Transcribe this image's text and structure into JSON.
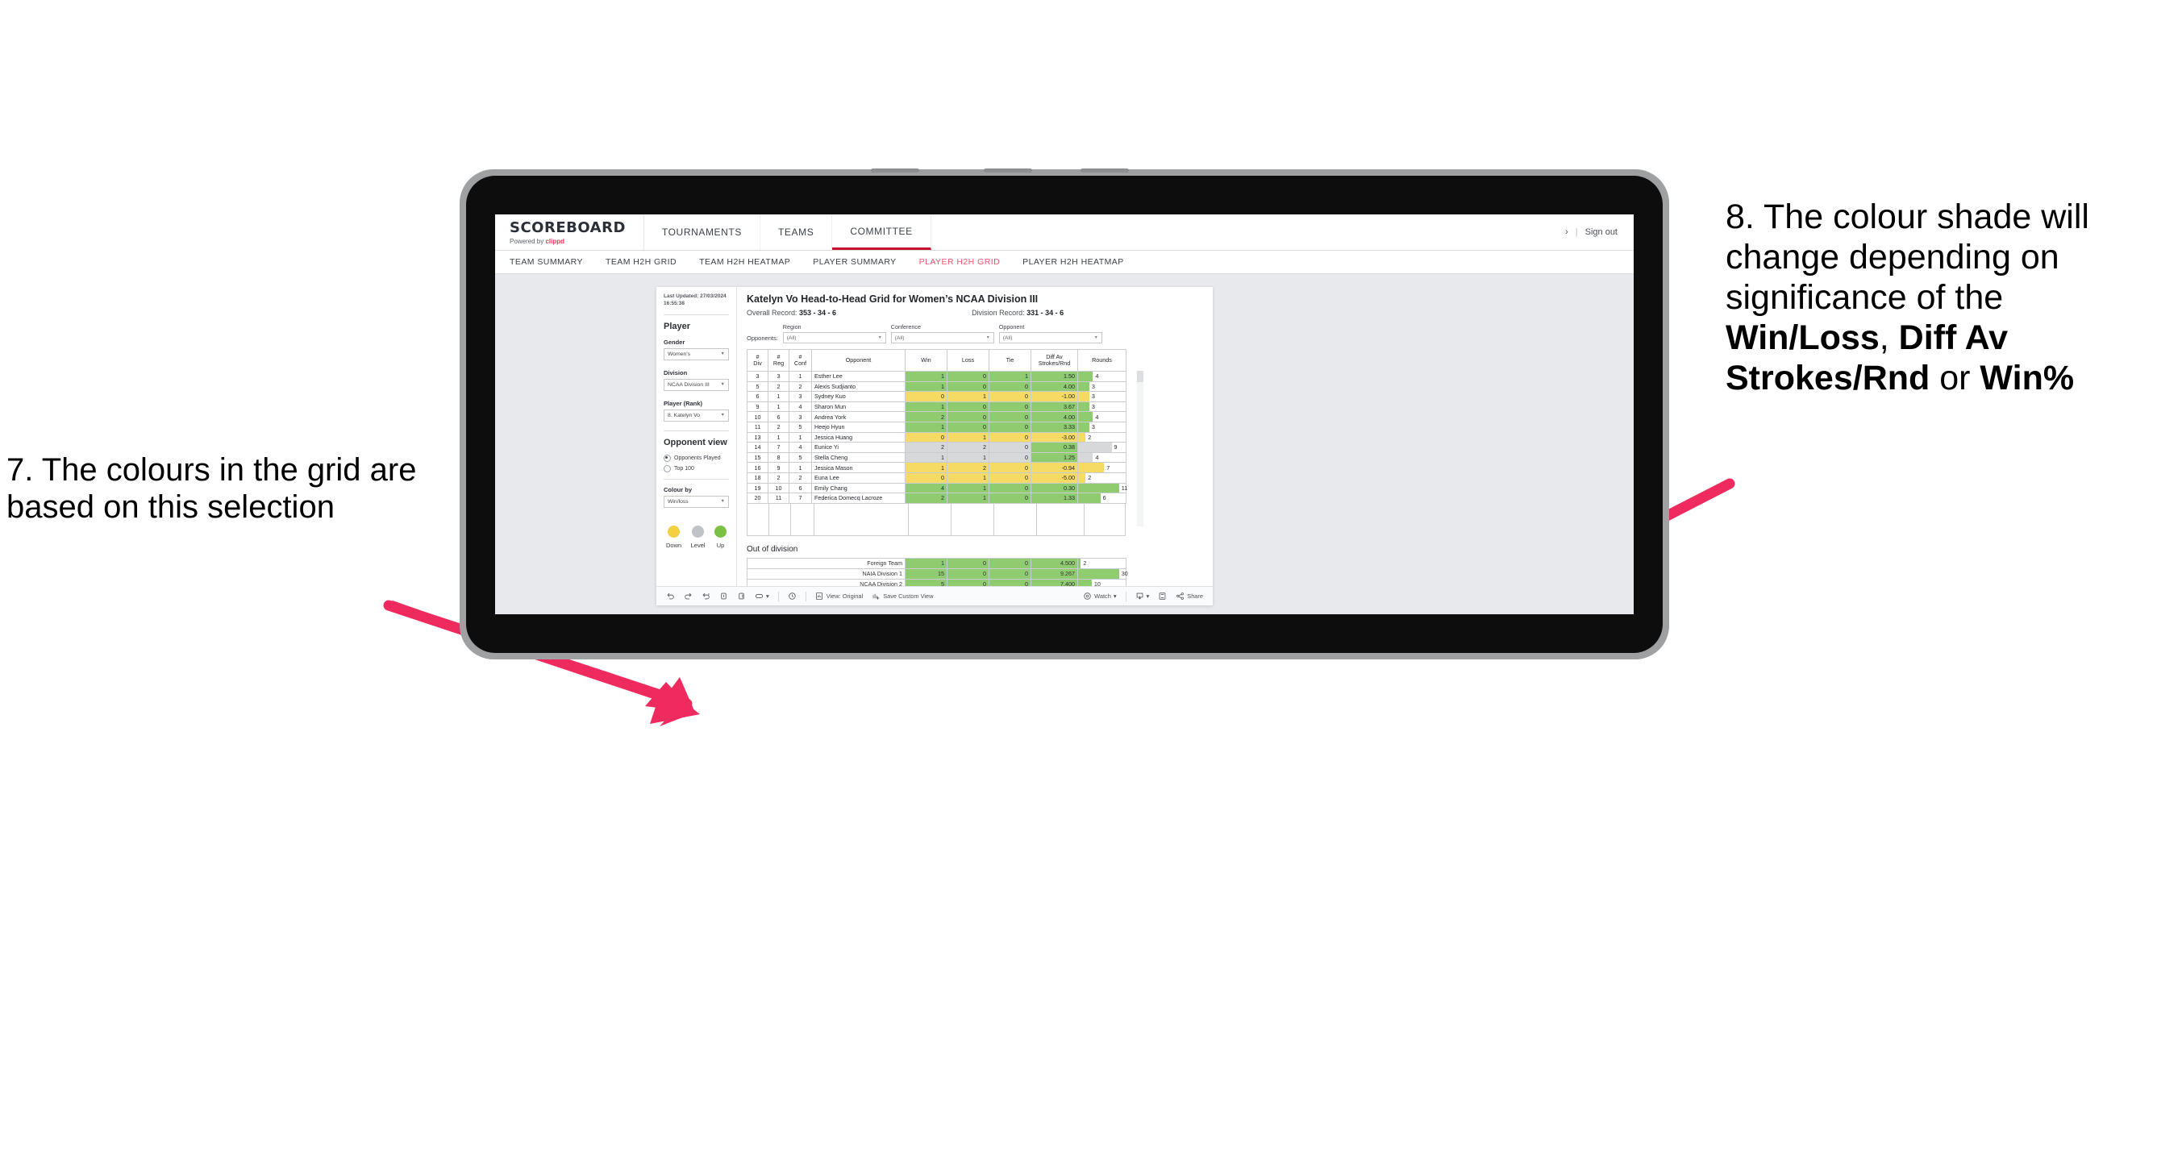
{
  "annotations": {
    "left": {
      "text": "7. The colours in the grid are based on this selection"
    },
    "right": {
      "p1": "8. The colour shade will change depending on significance of the ",
      "b1": "Win/Loss",
      "sep1": ", ",
      "b2": "Diff Av Strokes/Rnd",
      "sep2": " or ",
      "b3": "Win%"
    },
    "arrow_color": "#ef2a5e"
  },
  "app": {
    "brand": {
      "title": "SCOREBOARD",
      "powered_prefix": "Powered by ",
      "powered_name": "clippd"
    },
    "topnav": [
      {
        "label": "TOURNAMENTS",
        "active": false
      },
      {
        "label": "TEAMS",
        "active": false
      },
      {
        "label": "COMMITTEE",
        "active": true
      }
    ],
    "topbar_right": {
      "chevron": "›",
      "divider": "|",
      "sign_out": "Sign out"
    },
    "subnav": [
      {
        "label": "TEAM SUMMARY",
        "active": false
      },
      {
        "label": "TEAM H2H GRID",
        "active": false
      },
      {
        "label": "TEAM H2H HEATMAP",
        "active": false
      },
      {
        "label": "PLAYER SUMMARY",
        "active": false
      },
      {
        "label": "PLAYER H2H GRID",
        "active": true
      },
      {
        "label": "PLAYER H2H HEATMAP",
        "active": false
      }
    ]
  },
  "sidebar": {
    "last_updated": "Last Updated: 27/03/2024 16:55:38",
    "player_heading": "Player",
    "gender_label": "Gender",
    "gender_value": "Women’s",
    "division_label": "Division",
    "division_value": "NCAA Division III",
    "player_rank_label": "Player (Rank)",
    "player_rank_value": "8. Katelyn Vo",
    "opponent_view_heading": "Opponent view",
    "opponent_view_options": [
      {
        "label": "Opponents Played",
        "selected": true
      },
      {
        "label": "Top 100",
        "selected": false
      }
    ],
    "colour_by_label": "Colour by",
    "colour_by_value": "Win/loss",
    "legend": [
      {
        "label": "Down",
        "color": "#f2d03f"
      },
      {
        "label": "Level",
        "color": "#bfc2c6"
      },
      {
        "label": "Up",
        "color": "#7ac043"
      }
    ]
  },
  "main": {
    "title": "Katelyn Vo Head-to-Head Grid for Women’s NCAA Division III",
    "overall_record_label": "Overall Record: ",
    "overall_record_value": "353 - 34 - 6",
    "division_record_label": "Division Record: ",
    "division_record_value": "331 - 34 - 6",
    "opponents_label": "Opponents:",
    "filters": [
      {
        "label": "Region",
        "value": "(All)"
      },
      {
        "label": "Conference",
        "value": "(All)"
      },
      {
        "label": "Opponent",
        "value": "(All)"
      }
    ],
    "columns": [
      "# Div",
      "# Reg",
      "# Conf",
      "Opponent",
      "Win",
      "Loss",
      "Tie",
      "Diff Av Strokes/Rnd",
      "Rounds"
    ],
    "column_lines": [
      [
        "#",
        "Div"
      ],
      [
        "#",
        "Reg"
      ],
      [
        "#",
        "Conf"
      ],
      [
        "Opponent",
        ""
      ],
      [
        "Win",
        ""
      ],
      [
        "Loss",
        ""
      ],
      [
        "Tie",
        ""
      ],
      [
        "Diff Av",
        "Strokes/Rnd"
      ],
      [
        "Rounds",
        ""
      ]
    ],
    "rows": [
      {
        "div": "3",
        "reg": "3",
        "conf": "1",
        "opponent": "Esther Lee",
        "win": "1",
        "loss": "0",
        "tie": "1",
        "diff": "1.50",
        "rounds": "4",
        "shade": "up"
      },
      {
        "div": "5",
        "reg": "2",
        "conf": "2",
        "opponent": "Alexis Sudjianto",
        "win": "1",
        "loss": "0",
        "tie": "0",
        "diff": "4.00",
        "rounds": "3",
        "shade": "up"
      },
      {
        "div": "6",
        "reg": "1",
        "conf": "3",
        "opponent": "Sydney Kuo",
        "win": "0",
        "loss": "1",
        "tie": "0",
        "diff": "-1.00",
        "rounds": "3",
        "shade": "down"
      },
      {
        "div": "9",
        "reg": "1",
        "conf": "4",
        "opponent": "Sharon Mun",
        "win": "1",
        "loss": "0",
        "tie": "0",
        "diff": "3.67",
        "rounds": "3",
        "shade": "up"
      },
      {
        "div": "10",
        "reg": "6",
        "conf": "3",
        "opponent": "Andrea York",
        "win": "2",
        "loss": "0",
        "tie": "0",
        "diff": "4.00",
        "rounds": "4",
        "shade": "up"
      },
      {
        "div": "11",
        "reg": "2",
        "conf": "5",
        "opponent": "Heejo Hyun",
        "win": "1",
        "loss": "0",
        "tie": "0",
        "diff": "3.33",
        "rounds": "3",
        "shade": "up"
      },
      {
        "div": "13",
        "reg": "1",
        "conf": "1",
        "opponent": "Jessica Huang",
        "win": "0",
        "loss": "1",
        "tie": "0",
        "diff": "-3.00",
        "rounds": "2",
        "shade": "down"
      },
      {
        "div": "14",
        "reg": "7",
        "conf": "4",
        "opponent": "Eunice Yi",
        "win": "2",
        "loss": "2",
        "tie": "0",
        "diff": "0.38",
        "rounds": "9",
        "shade": "level",
        "diff_shade": "up"
      },
      {
        "div": "15",
        "reg": "8",
        "conf": "5",
        "opponent": "Stella Cheng",
        "win": "1",
        "loss": "1",
        "tie": "0",
        "diff": "1.25",
        "rounds": "4",
        "shade": "level",
        "diff_shade": "up"
      },
      {
        "div": "16",
        "reg": "9",
        "conf": "1",
        "opponent": "Jessica Mason",
        "win": "1",
        "loss": "2",
        "tie": "0",
        "diff": "-0.94",
        "rounds": "7",
        "shade": "down"
      },
      {
        "div": "18",
        "reg": "2",
        "conf": "2",
        "opponent": "Euna Lee",
        "win": "0",
        "loss": "1",
        "tie": "0",
        "diff": "-5.00",
        "rounds": "2",
        "shade": "down"
      },
      {
        "div": "19",
        "reg": "10",
        "conf": "6",
        "opponent": "Emily Chang",
        "win": "4",
        "loss": "1",
        "tie": "0",
        "diff": "0.30",
        "rounds": "11",
        "shade": "up"
      },
      {
        "div": "20",
        "reg": "11",
        "conf": "7",
        "opponent": "Federica Domecq Lacroze",
        "win": "2",
        "loss": "1",
        "tie": "0",
        "diff": "1.33",
        "rounds": "6",
        "shade": "up"
      }
    ],
    "rounds_max": 11,
    "out_of_division_label": "Out of division",
    "out_of_division": [
      {
        "name": "Foreign Team",
        "win": "1",
        "loss": "0",
        "tie": "0",
        "diff": "4.500",
        "rounds": "2",
        "shade": "up"
      },
      {
        "name": "NAIA Division 1",
        "win": "15",
        "loss": "0",
        "tie": "0",
        "diff": "9.267",
        "rounds": "30",
        "shade": "up"
      },
      {
        "name": "NCAA Division 2",
        "win": "5",
        "loss": "0",
        "tie": "0",
        "diff": "7.400",
        "rounds": "10",
        "shade": "up"
      }
    ],
    "ood_rounds_max": 30
  },
  "toolbar": {
    "undo_icon": "undo-icon",
    "redo_icon": "redo-icon",
    "revert_icon": "revert-icon",
    "refresh_icon": "refresh-icon",
    "pause_icon": "pause-icon",
    "shape_icon": "shape-icon",
    "caret": "▾",
    "clock_icon": "clock-icon",
    "view_label": "View: Original",
    "save_label": "Save Custom View",
    "watch_label": "Watch",
    "download_icon": "download-icon",
    "fullscreen_icon": "fullscreen-icon",
    "share_label": "Share"
  },
  "colors": {
    "up": "#8fcc70",
    "down": "#f5da63",
    "level": "#d6d8da",
    "accent_red": "#c8102e",
    "accent_pink": "#f2506e"
  }
}
